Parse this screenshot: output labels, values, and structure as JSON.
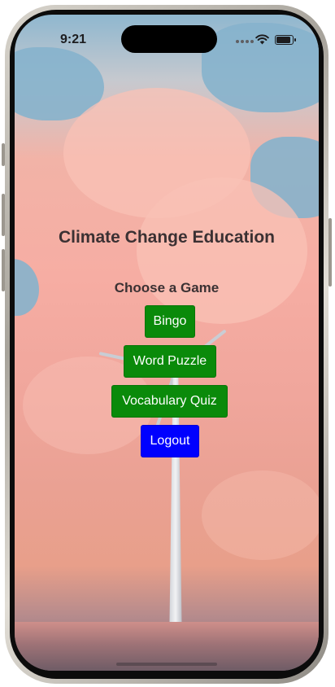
{
  "status_bar": {
    "time": "9:21"
  },
  "app": {
    "title": "Climate Change Education",
    "subtitle": "Choose a Game"
  },
  "buttons": {
    "bingo": "Bingo",
    "word_puzzle": "Word Puzzle",
    "vocabulary_quiz": "Vocabulary Quiz",
    "logout": "Logout"
  },
  "colors": {
    "game_button": "#0a8a0a",
    "logout_button": "#0000ff",
    "heading_text": "#3b3133"
  },
  "icons": {
    "signal": "cellular-signal-icon",
    "wifi": "wifi-icon",
    "battery": "battery-icon"
  }
}
